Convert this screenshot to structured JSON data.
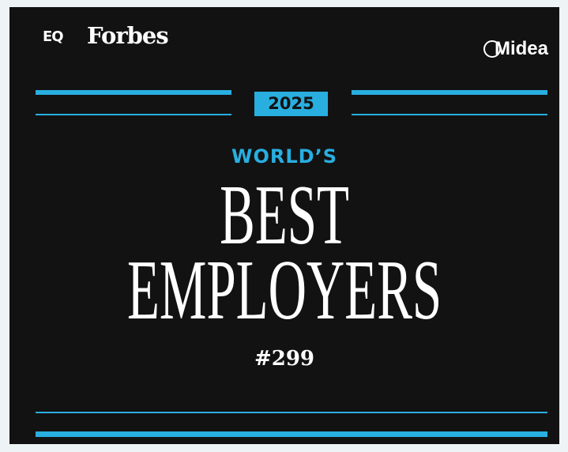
{
  "logos": {
    "eq": "EQ",
    "forbes": "Forbes",
    "midea": "Midea"
  },
  "badge": {
    "year": "2025",
    "kicker": "WORLD’S",
    "title_line1": "BEST",
    "title_line2": "EMPLOYERS",
    "rank": "#299"
  },
  "colors": {
    "background": "#121212",
    "accent": "#29aee0",
    "text": "#ffffff"
  }
}
